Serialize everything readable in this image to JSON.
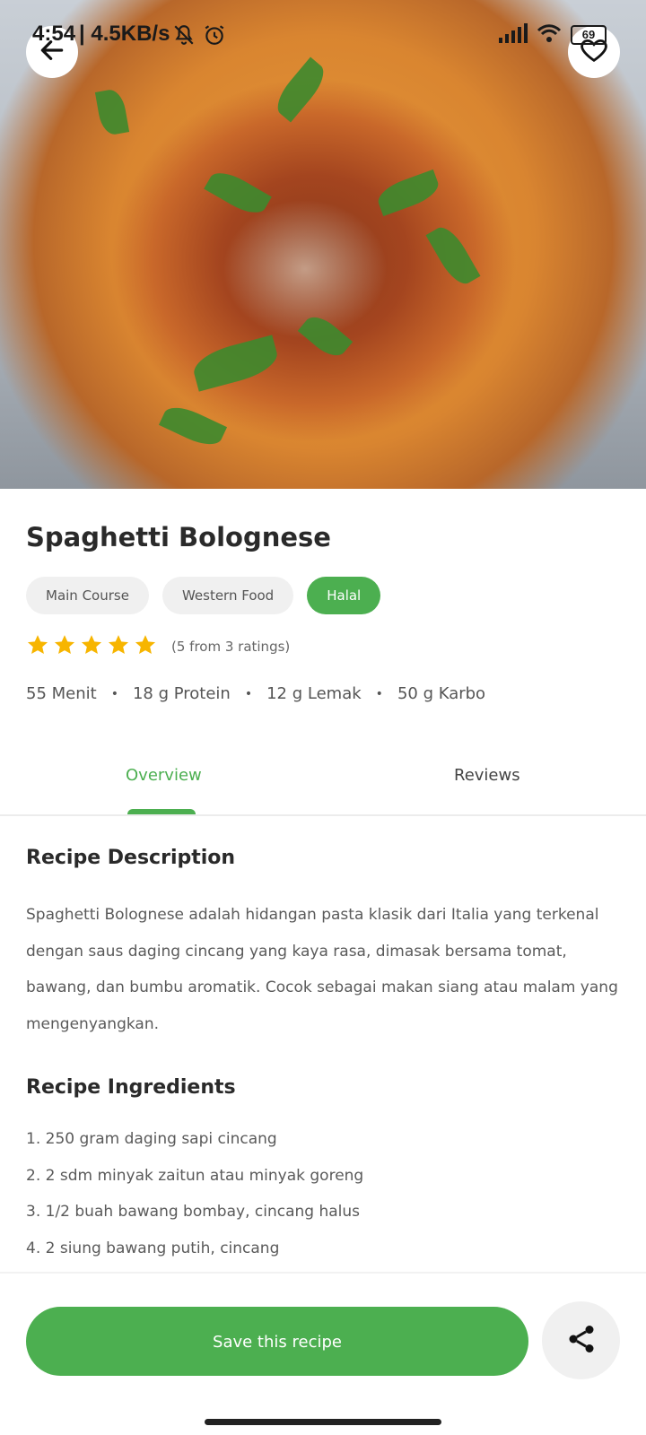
{
  "status_bar": {
    "time": "4:54",
    "network_speed": "| 4.5KB/s",
    "battery": "69"
  },
  "recipe": {
    "title": "Spaghetti Bolognese",
    "tags": [
      {
        "label": "Main Course",
        "active": false
      },
      {
        "label": "Western Food",
        "active": false
      },
      {
        "label": "Halal",
        "active": true
      }
    ],
    "rating": {
      "stars": 5,
      "text": "(5 from 3 ratings)"
    },
    "meta": {
      "duration": "55 Menit",
      "protein": "18 g Protein",
      "fat": "12 g Lemak",
      "carbs": "50 g Karbo"
    }
  },
  "tabs": [
    {
      "label": "Overview",
      "selected": true
    },
    {
      "label": "Reviews",
      "selected": false
    }
  ],
  "description": {
    "heading": "Recipe Description",
    "text": "Spaghetti Bolognese adalah hidangan pasta klasik dari Italia yang terkenal dengan saus daging cincang yang kaya rasa, dimasak bersama tomat, bawang, dan bumbu aromatik. Cocok sebagai makan siang atau malam yang mengenyangkan."
  },
  "ingredients": {
    "heading": "Recipe Ingredients",
    "items": [
      "1. 250 gram daging sapi cincang",
      "2. 2 sdm minyak zaitun atau minyak goreng",
      "3. 1/2 buah bawang bombay, cincang halus",
      "4. 2 siung bawang putih, cincang"
    ]
  },
  "actions": {
    "save_label": "Save this recipe"
  },
  "colors": {
    "accent": "#4caf50",
    "star": "#f7b500",
    "chip_bg": "#f0f0f0"
  },
  "icons": {
    "back": "arrow-left-icon",
    "favorite": "heart-icon",
    "share": "share-icon",
    "star": "star-icon"
  }
}
